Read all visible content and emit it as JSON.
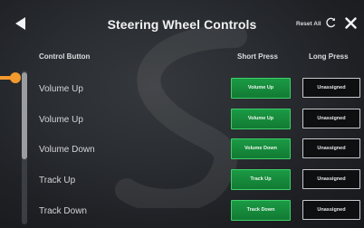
{
  "header": {
    "title": "Steering Wheel Controls",
    "reset_all_label": "Reset All"
  },
  "columns": {
    "control": "Control Button",
    "short": "Short Press",
    "long": "Long Press"
  },
  "rows": [
    {
      "label": "Volume Up",
      "short": "Volume Up",
      "long": "Unassigned"
    },
    {
      "label": "Volume Up",
      "short": "Volume Up",
      "long": "Unassigned"
    },
    {
      "label": "Volume Down",
      "short": "Volume Down",
      "long": "Unassigned"
    },
    {
      "label": "Track Up",
      "short": "Track Up",
      "long": "Unassigned"
    },
    {
      "label": "Track Down",
      "short": "Track Down",
      "long": "Unassigned"
    }
  ],
  "colors": {
    "accent": "#f29a2e",
    "assigned": "#1b9a44",
    "background": "#2a2d31"
  },
  "icons": {
    "back": "back-arrow-icon",
    "refresh": "refresh-icon",
    "close": "close-icon"
  }
}
